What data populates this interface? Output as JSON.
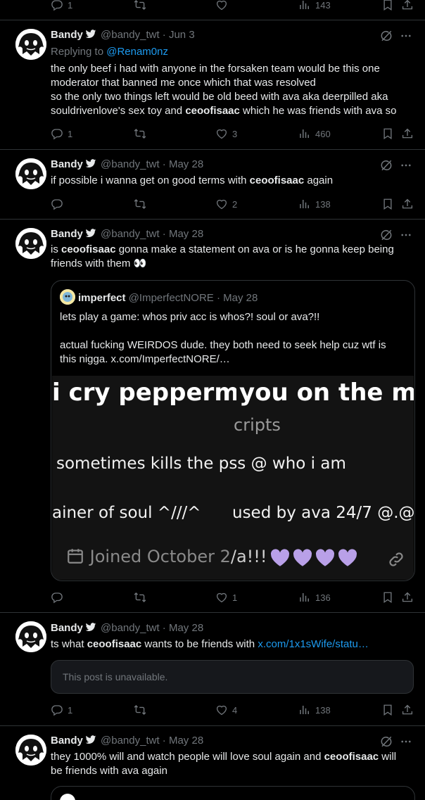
{
  "top_actions": {
    "replies": "1",
    "views": "143"
  },
  "tweets": [
    {
      "name": "Bandy",
      "handle": "@bandy_twt",
      "date": "Jun 3",
      "replying_label": "Replying to",
      "replying_handle": "@Renam0nz",
      "text_lines": [
        "the only beef i had with anyone in the forsaken team would be this one",
        "moderator that banned me once which that was resolved",
        "so the only two things left would be old beed with ava aka deerpilled aka",
        "souldrivenlove's sex toy and ",
        "ceoofisaac",
        " which he was friends with ava so"
      ],
      "replies": "1",
      "reposts": "",
      "likes": "3",
      "views": "460"
    },
    {
      "name": "Bandy",
      "handle": "@bandy_twt",
      "date": "May 28",
      "text_a": "if possible i wanna get on good terms with ",
      "text_bold": "ceoofisaac",
      "text_b": " again",
      "replies": "",
      "reposts": "",
      "likes": "2",
      "views": "138"
    },
    {
      "name": "Bandy",
      "handle": "@bandy_twt",
      "date": "May 28",
      "text_a": "is ",
      "text_bold": "ceoofisaac",
      "text_b": " gonna make a statement on ava or is he gonna keep being",
      "text_c": "friends with them 👀",
      "quote": {
        "name": "imperfect",
        "handle": "@ImperfectNORE",
        "date": "May 28",
        "line1": "lets play a game: whos priv acc is whos?! soul or ava?!!",
        "line2": "actual fucking WEIRDOS dude. they both need to seek help cuz wtf is",
        "line3": "this nigga.  x.com/ImperfectNORE/…",
        "img_left_title": "i cry peppermin",
        "img_right_title": "you on the moo",
        "img_cripts": "cripts",
        "img_line2": "sometimes kills the p",
        "img_line2b": "ss @ who i am",
        "img_line3a": "ainer of soul ^///^",
        "img_line3b": "used by ava 24/7 @.@",
        "img_joined": "Joined October 2",
        "img_ava": "/a!!!"
      },
      "replies": "",
      "reposts": "",
      "likes": "1",
      "views": "136"
    },
    {
      "name": "Bandy",
      "handle": "@bandy_twt",
      "date": "May 28",
      "text_a": "ts what ",
      "text_bold": "ceoofisaac",
      "text_b": " wants to be friends with ",
      "link": "x.com/1x1sWife/statu…",
      "unavailable": "This post is unavailable.",
      "replies": "1",
      "reposts": "",
      "likes": "4",
      "views": "138"
    },
    {
      "name": "Bandy",
      "handle": "@bandy_twt",
      "date": "May 28",
      "text_a": "they 1000% will and watch people will love soul again and ",
      "text_bold": "ceoofisaac",
      "text_b": " will",
      "text_c": "be friends with ava again"
    }
  ],
  "colors": {
    "accent": "#1d9bf0",
    "muted": "#71767b",
    "border": "#2f3336",
    "heart_purple": "#b9a0e8"
  }
}
